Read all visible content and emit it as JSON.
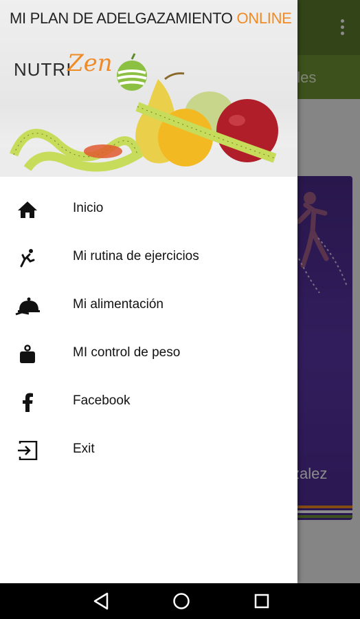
{
  "background_app": {
    "tab_text": "bles",
    "card_text": "zalez",
    "toolbar_color": "#5e7f2d",
    "tabbar_color": "#6f9434"
  },
  "drawer": {
    "header": {
      "title_main": "MI PLAN DE ADELGAZAMIENTO ",
      "title_accent": "ONLINE",
      "logo_nutri": "NUTRI",
      "logo_zen": "Zen",
      "accent_color": "#f08a24"
    },
    "menu": [
      {
        "label": "Inicio",
        "icon": "home-icon"
      },
      {
        "label": "Mi rutina de ejercicios",
        "icon": "exercise-icon"
      },
      {
        "label": "Mi alimentación",
        "icon": "food-cloche-icon"
      },
      {
        "label": "MI control de peso",
        "icon": "weight-icon"
      },
      {
        "label": "Facebook",
        "icon": "facebook-icon"
      },
      {
        "label": "Exit",
        "icon": "exit-icon"
      }
    ]
  },
  "navbar": {
    "buttons": [
      "back-icon",
      "home-circle-icon",
      "recents-icon"
    ]
  }
}
